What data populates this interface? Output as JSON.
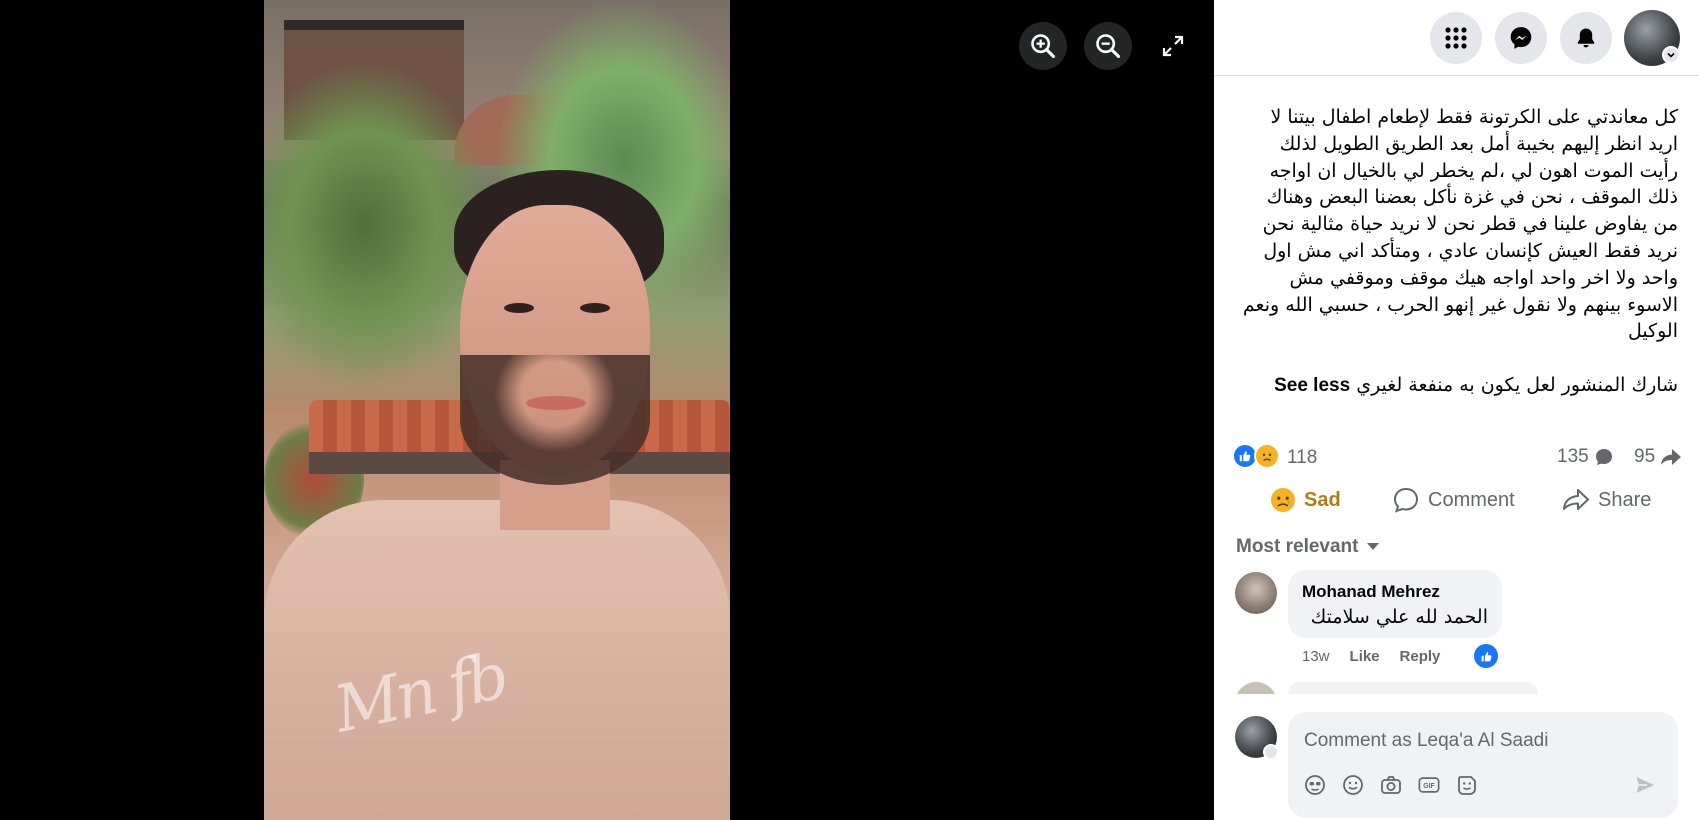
{
  "viewer": {
    "zoom_in": "zoom in",
    "zoom_out": "zoom out",
    "fullscreen": "fullscreen"
  },
  "topbar": {
    "menu": "menu",
    "messenger": "messenger",
    "notifications": "notifications"
  },
  "post": {
    "text": "كل معاندتي على الكرتونة فقط لإطعام اطفال بيتنا لا اريد انظر إليهم بخيبة أمل بعد الطريق الطويل لذلك رأيت الموت اهون لي ،لم يخطر لي بالخيال ان اواجه ذلك الموقف ، نحن في غزة نأكل بعضنا البعض وهناك من يفاوض علينا في قطر نحن لا نريد حياة مثالية نحن نريد فقط العيش كإنسان عادي ، ومتأكد اني مش اول واحد ولا اخر واحد اواجه هيك موقف وموقفي مش الاسوء بينهم ولا نقول غير إنهو الحرب ، حسبي الله ونعم الوكيل",
    "share_text": "شارك المنشور لعل يكون به منفعة لغيري",
    "see_less": "See less",
    "reaction_count": "118",
    "comment_count": "135",
    "share_count": "95"
  },
  "actions": {
    "sad": "Sad",
    "comment": "Comment",
    "share": "Share"
  },
  "comments": {
    "sort_label": "Most relevant",
    "items": [
      {
        "name": "Mohanad Mehrez",
        "text": "الحمد لله علي سلامتك",
        "time": "13w",
        "like": "Like",
        "reply": "Reply"
      }
    ]
  },
  "composer": {
    "placeholder": "Comment as Leqa'a Al Saadi"
  },
  "colors": {
    "brand_blue": "#1877f2",
    "sad_yellow": "#b07e0f",
    "muted": "#65676b"
  }
}
